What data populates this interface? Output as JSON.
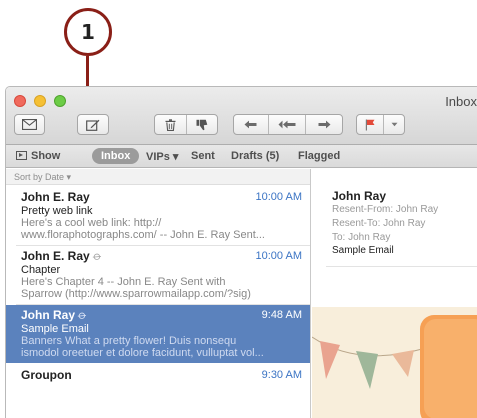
{
  "callout": {
    "number": "1"
  },
  "window": {
    "title": "Inbox"
  },
  "toolbar": {
    "buttons": [
      {
        "name": "get-mail-button",
        "icon": "envelope-icon"
      },
      {
        "name": "compose-button",
        "icon": "compose-icon"
      },
      {
        "name": "delete-button",
        "icon": "trash-icon"
      },
      {
        "name": "junk-button",
        "icon": "thumbs-down-icon"
      },
      {
        "name": "reply-button",
        "icon": "reply-icon"
      },
      {
        "name": "reply-all-button",
        "icon": "reply-all-icon"
      },
      {
        "name": "forward-button",
        "icon": "forward-icon"
      },
      {
        "name": "flag-button",
        "icon": "flag-icon"
      },
      {
        "name": "flag-menu-button",
        "icon": "chevron-down-icon"
      }
    ]
  },
  "favorites": {
    "show": "Show",
    "inbox": "Inbox",
    "vips": "VIPs ▾",
    "sent": "Sent",
    "drafts": "Drafts (5)",
    "flagged": "Flagged"
  },
  "list": {
    "sort_label": "Sort by Date ▾",
    "messages": [
      {
        "from": "John E. Ray",
        "time": "10:00 AM",
        "subject": "Pretty web link",
        "preview": [
          "Here's a cool web link: http://",
          "www.floraphotographs.com/ -- John E. Ray Sent..."
        ],
        "attachment": false
      },
      {
        "from": "John E. Ray",
        "time": "10:00 AM",
        "subject": "Chapter",
        "preview": [
          "Here's Chapter 4 -- John E. Ray Sent with",
          "Sparrow (http://www.sparrowmailapp.com/?sig)"
        ],
        "attachment": true
      },
      {
        "from": "John Ray",
        "time": "9:48 AM",
        "subject": "Sample Email",
        "preview": [
          "Banners What a pretty flower! Duis nonsequ",
          "ismodol oreetuer et dolore facidunt, vulluptat vol..."
        ],
        "attachment": true,
        "selected": true
      },
      {
        "from": "Groupon",
        "time": "9:30 AM",
        "subject": "",
        "preview": [],
        "attachment": false
      }
    ]
  },
  "message": {
    "from": "John Ray",
    "resent_from": "Resent-From:  John Ray",
    "resent_to": "Resent-To:  John Ray",
    "to": "To:  John Ray",
    "subject": "Sample Email"
  },
  "colors": {
    "selection": "#5b82bd",
    "time_text": "#3b74c4",
    "callout": "#8a1f17"
  }
}
